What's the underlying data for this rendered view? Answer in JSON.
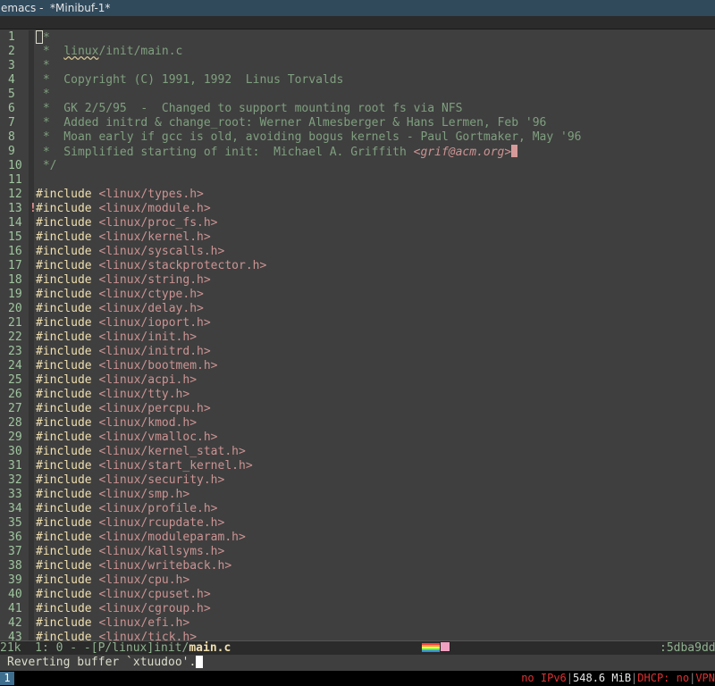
{
  "window": {
    "title": "emacs -  *Minibuf-1*"
  },
  "buffer": {
    "lines": [
      {
        "n": "1"
      },
      {
        "n": "2",
        "t": " *  linux/init/main.c"
      },
      {
        "n": "3",
        "t": " *"
      },
      {
        "n": "4",
        "t": " *  Copyright (C) 1991, 1992  Linus Torvalds"
      },
      {
        "n": "5",
        "t": " *"
      },
      {
        "n": "6",
        "t": " *  GK 2/5/95  -  Changed to support mounting root fs via NFS"
      },
      {
        "n": "7",
        "t": " *  Added initrd & change_root: Werner Almesberger & Hans Lermen, Feb '96"
      },
      {
        "n": "8",
        "t": " *  Moan early if gcc is old, avoiding bogus kernels - Paul Gortmaker, May '96"
      },
      {
        "n": "9",
        "t": " *  Simplified starting of init:  Michael A. Griffith "
      },
      {
        "n": "10",
        "t": " */"
      },
      {
        "n": "11",
        "t": ""
      },
      {
        "n": "12",
        "i": "#include",
        "h": "<linux/types.h>"
      },
      {
        "n": "13",
        "i": "#include",
        "h": "<linux/module.h>"
      },
      {
        "n": "14",
        "i": "#include",
        "h": "<linux/proc_fs.h>"
      },
      {
        "n": "15",
        "i": "#include",
        "h": "<linux/kernel.h>"
      },
      {
        "n": "16",
        "i": "#include",
        "h": "<linux/syscalls.h>"
      },
      {
        "n": "17",
        "i": "#include",
        "h": "<linux/stackprotector.h>"
      },
      {
        "n": "18",
        "i": "#include",
        "h": "<linux/string.h>"
      },
      {
        "n": "19",
        "i": "#include",
        "h": "<linux/ctype.h>"
      },
      {
        "n": "20",
        "i": "#include",
        "h": "<linux/delay.h>"
      },
      {
        "n": "21",
        "i": "#include",
        "h": "<linux/ioport.h>"
      },
      {
        "n": "22",
        "i": "#include",
        "h": "<linux/init.h>"
      },
      {
        "n": "23",
        "i": "#include",
        "h": "<linux/initrd.h>"
      },
      {
        "n": "24",
        "i": "#include",
        "h": "<linux/bootmem.h>"
      },
      {
        "n": "25",
        "i": "#include",
        "h": "<linux/acpi.h>"
      },
      {
        "n": "26",
        "i": "#include",
        "h": "<linux/tty.h>"
      },
      {
        "n": "27",
        "i": "#include",
        "h": "<linux/percpu.h>"
      },
      {
        "n": "28",
        "i": "#include",
        "h": "<linux/kmod.h>"
      },
      {
        "n": "29",
        "i": "#include",
        "h": "<linux/vmalloc.h>"
      },
      {
        "n": "30",
        "i": "#include",
        "h": "<linux/kernel_stat.h>"
      },
      {
        "n": "31",
        "i": "#include",
        "h": "<linux/start_kernel.h>"
      },
      {
        "n": "32",
        "i": "#include",
        "h": "<linux/security.h>"
      },
      {
        "n": "33",
        "i": "#include",
        "h": "<linux/smp.h>"
      },
      {
        "n": "34",
        "i": "#include",
        "h": "<linux/profile.h>"
      },
      {
        "n": "35",
        "i": "#include",
        "h": "<linux/rcupdate.h>"
      },
      {
        "n": "36",
        "i": "#include",
        "h": "<linux/moduleparam.h>"
      },
      {
        "n": "37",
        "i": "#include",
        "h": "<linux/kallsyms.h>"
      },
      {
        "n": "38",
        "i": "#include",
        "h": "<linux/writeback.h>"
      },
      {
        "n": "39",
        "i": "#include",
        "h": "<linux/cpu.h>"
      },
      {
        "n": "40",
        "i": "#include",
        "h": "<linux/cpuset.h>"
      },
      {
        "n": "41",
        "i": "#include",
        "h": "<linux/cgroup.h>"
      },
      {
        "n": "42",
        "i": "#include",
        "h": "<linux/efi.h>"
      },
      {
        "n": "43",
        "i": "#include",
        "h": "<linux/tick.h>"
      }
    ],
    "first_line_comment": "/*",
    "email": "<grif@acm.org>",
    "warning_mark": "!"
  },
  "modeline": {
    "size": "21k",
    "position": "  1: 0 - -",
    "path": "[P/linux]init/",
    "filename": "main.c",
    "hash": ":5dba9dd"
  },
  "minibuffer": {
    "message": "Reverting buffer `xtuudoo'."
  },
  "statusbar": {
    "workspace": "1",
    "ipv6": "no IPv6",
    "memory": "548.6 MiB",
    "dhcp": "DHCP: no",
    "vpn": "VPN"
  },
  "colors": {
    "background": "#3f3f3f",
    "comment": "#7f9f7f",
    "keyword": "#f0dfaf",
    "string": "#cc9393",
    "linenumber": "#9fc59f",
    "titlebar": "#304a5c"
  }
}
